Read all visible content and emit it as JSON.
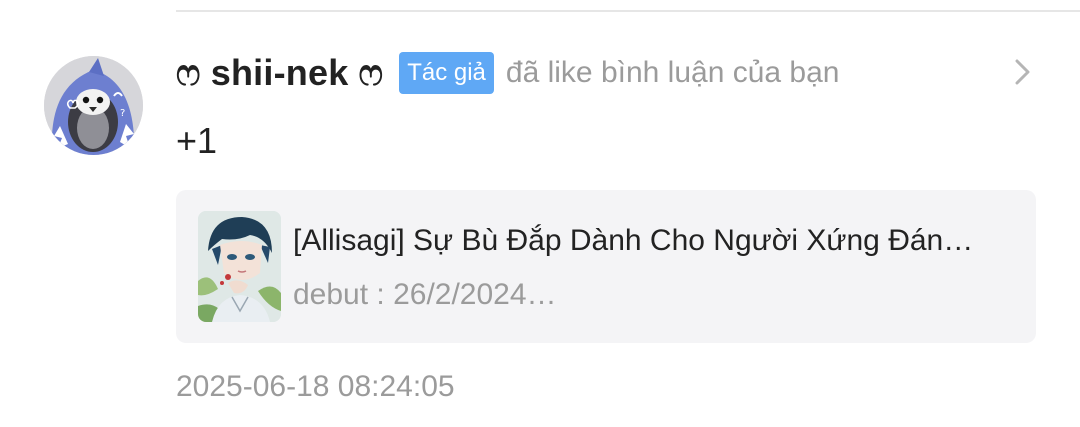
{
  "notification": {
    "username": "ෆ shii-nek ෆ",
    "author_badge": "Tác giả",
    "action_text": "đã like bình luận của bạn",
    "comment_text": "+1",
    "timestamp": "2025-06-18 08:24:05",
    "avatar_icon": "penguin-shark-avatar",
    "chevron_icon": "chevron-right-icon",
    "story": {
      "title": "[Allisagi] Sự Bù Đắp Dành Cho Người Xứng Đán…",
      "subtitle": "debut : 26/2/2024…",
      "cover_icon": "anime-boy-cover"
    }
  },
  "colors": {
    "badge_bg": "#5fa8f5",
    "muted_text": "#9b9b9b",
    "card_bg": "#f4f4f6",
    "primary_text": "#222222"
  }
}
